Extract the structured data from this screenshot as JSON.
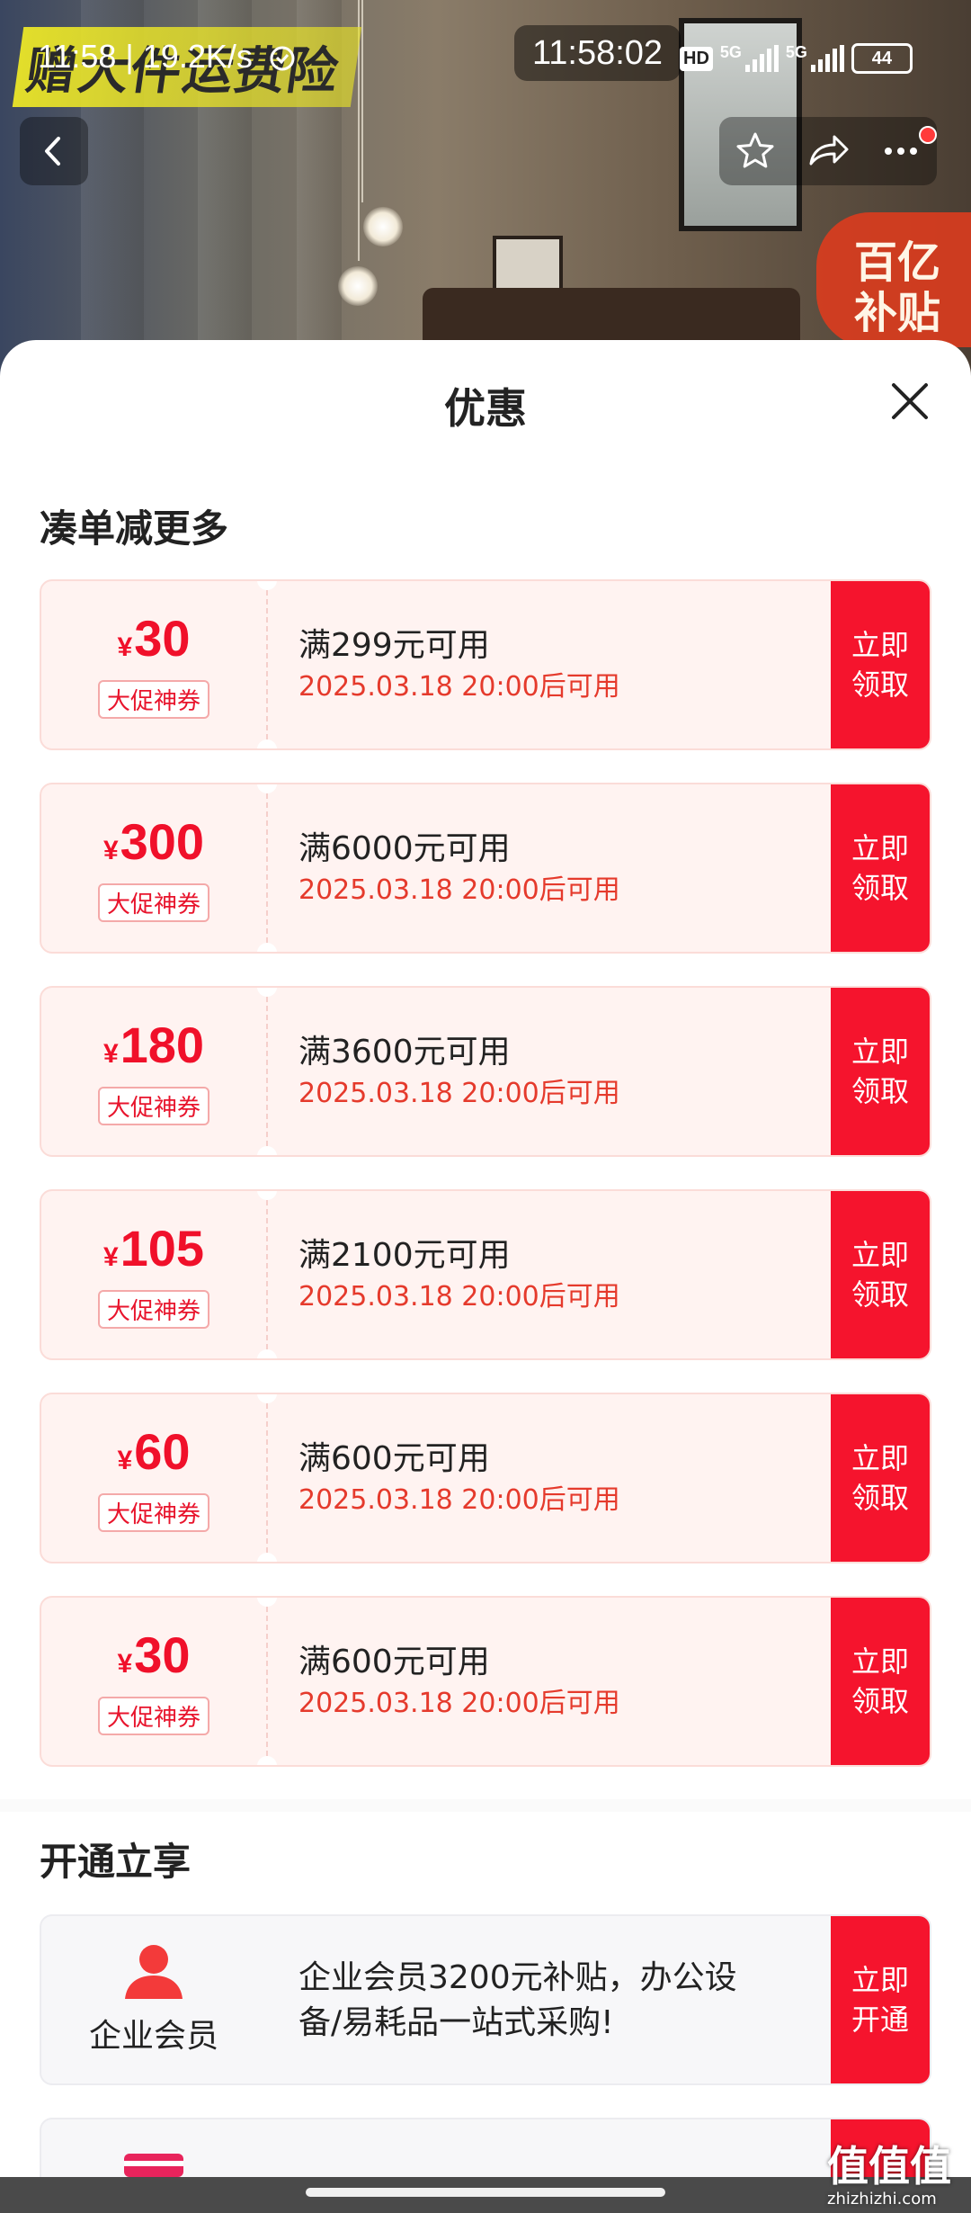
{
  "banner": {
    "promo_text": "赠大件运费险",
    "subsidy_text": [
      "百亿",
      "补贴"
    ]
  },
  "status_bar": {
    "network_left": "11:58 | 19.2K/s",
    "clock": "11:58:02",
    "hd": "HD",
    "net1": "5G",
    "net2": "5G",
    "battery": "44"
  },
  "nav": {
    "back_icon": "chevron-left-icon",
    "favorite_icon": "star-icon",
    "share_icon": "share-icon",
    "more_icon": "more-dots-icon"
  },
  "sheet": {
    "title": "优惠",
    "section_coupons": "凑单减更多",
    "coupons": [
      {
        "currency": "¥",
        "amount": "30",
        "tag": "大促神券",
        "condition": "满299元可用",
        "date": "2025.03.18 20:00后可用",
        "btn": [
          "立即",
          "领取"
        ]
      },
      {
        "currency": "¥",
        "amount": "300",
        "tag": "大促神券",
        "condition": "满6000元可用",
        "date": "2025.03.18 20:00后可用",
        "btn": [
          "立即",
          "领取"
        ]
      },
      {
        "currency": "¥",
        "amount": "180",
        "tag": "大促神券",
        "condition": "满3600元可用",
        "date": "2025.03.18 20:00后可用",
        "btn": [
          "立即",
          "领取"
        ]
      },
      {
        "currency": "¥",
        "amount": "105",
        "tag": "大促神券",
        "condition": "满2100元可用",
        "date": "2025.03.18 20:00后可用",
        "btn": [
          "立即",
          "领取"
        ]
      },
      {
        "currency": "¥",
        "amount": "60",
        "tag": "大促神券",
        "condition": "满600元可用",
        "date": "2025.03.18 20:00后可用",
        "btn": [
          "立即",
          "领取"
        ]
      },
      {
        "currency": "¥",
        "amount": "30",
        "tag": "大促神券",
        "condition": "满600元可用",
        "date": "2025.03.18 20:00后可用",
        "btn": [
          "立即",
          "领取"
        ]
      }
    ],
    "section_membership": "开通立享",
    "membership": {
      "icon": "person-icon",
      "label": "企业会员",
      "description_line1": "企业会员3200元补贴，办公设",
      "description_line2": "备/易耗品一站式采购!",
      "btn": [
        "立即",
        "开通"
      ]
    }
  },
  "watermark": {
    "text": "值值值",
    "sub": "zhizhizhi.com"
  },
  "colors": {
    "accent": "#f5142d",
    "date_red": "#e53a2c",
    "coupon_bg": "#fff3f1"
  }
}
